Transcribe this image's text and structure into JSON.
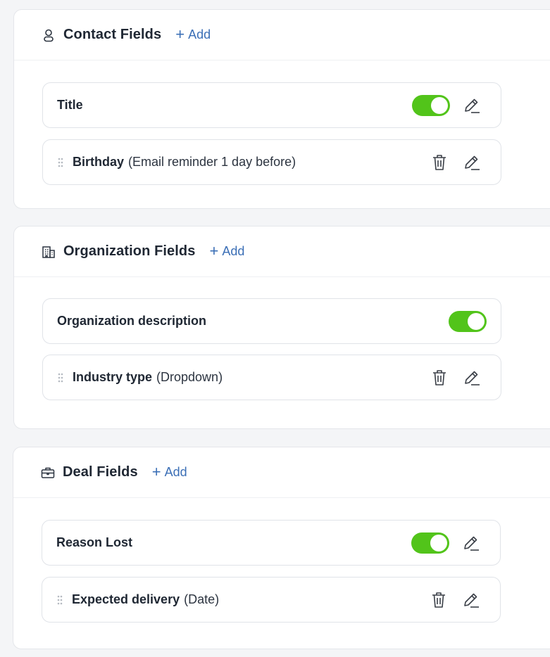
{
  "sections": [
    {
      "title": "Contact Fields",
      "icon": "user-icon",
      "add_label": "Add",
      "fields": [
        {
          "label": "Title",
          "note": "",
          "type": "toggle",
          "enabled": true
        },
        {
          "label": "Birthday",
          "note": "(Email reminder 1 day before)",
          "type": "custom"
        }
      ]
    },
    {
      "title": "Organization Fields",
      "icon": "building-icon",
      "add_label": "Add",
      "fields": [
        {
          "label": "Organization description",
          "note": "",
          "type": "toggle",
          "enabled": true
        },
        {
          "label": "Industry type",
          "note": "(Dropdown)",
          "type": "custom"
        }
      ]
    },
    {
      "title": "Deal Fields",
      "icon": "briefcase-icon",
      "add_label": "Add",
      "fields": [
        {
          "label": "Reason Lost",
          "note": "",
          "type": "toggle",
          "enabled": true
        },
        {
          "label": "Expected delivery",
          "note": "(Date)",
          "type": "custom"
        }
      ]
    }
  ],
  "colors": {
    "toggle_on": "#52c41a",
    "link": "#3b6fb6",
    "text": "#1f2733"
  }
}
